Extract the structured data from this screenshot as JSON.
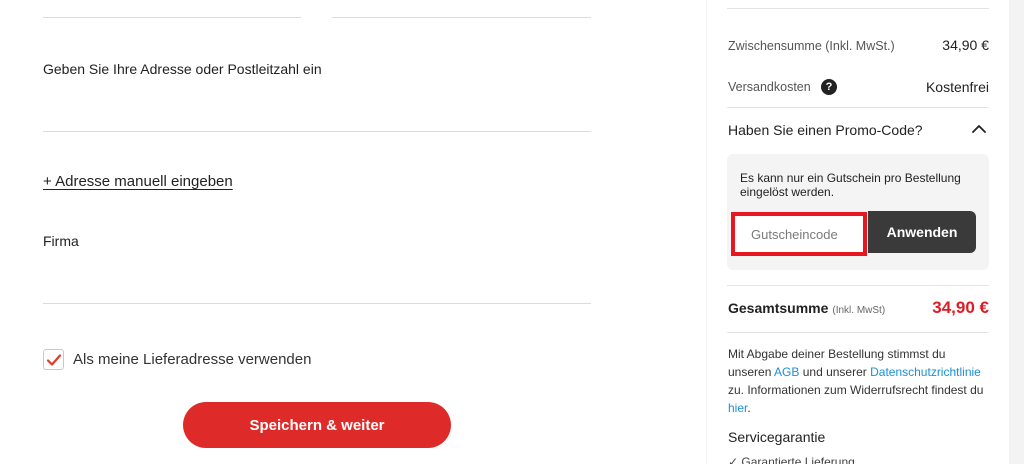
{
  "form": {
    "address_label": "Geben Sie Ihre Adresse oder Postleitzahl ein",
    "manual_address_link": "+ Adresse manuell eingeben",
    "company_label": "Firma",
    "use_as_shipping_label": "Als meine Lieferadresse verwenden",
    "use_as_shipping_checked": true,
    "submit_label": "Speichern & weiter"
  },
  "summary": {
    "subtotal_label": "Zwischensumme (Inkl. MwSt.)",
    "subtotal_value": "34,90 €",
    "shipping_label": "Versandkosten",
    "shipping_help_icon": "?",
    "shipping_value": "Kostenfrei",
    "promo": {
      "title": "Haben Sie einen Promo-Code?",
      "note": "Es kann nur ein Gutschein pro Bestellung eingelöst werden.",
      "voucher_placeholder": "Gutscheincode",
      "apply_label": "Anwenden"
    },
    "total_label": "Gesamtsumme",
    "total_note": "(Inkl. MwSt)",
    "total_value": "34,90 €",
    "legal": {
      "part1": "Mit Abgabe deiner Bestellung stimmst du unseren ",
      "agb_link": "AGB",
      "part2": " und unserer ",
      "privacy_link": "Datenschutzrichtlinie",
      "part3": " zu. Informationen zum Widerrufsrecht findest du ",
      "here_link": "hier",
      "part4": "."
    },
    "service_title": "Servicegarantie",
    "guarantee_item": "✓ Garantierte Lieferung"
  },
  "colors": {
    "primary_red": "#df2a2a",
    "total_red": "#e01b24",
    "highlight_red": "#e8171f",
    "link_blue": "#1a8fd8",
    "apply_dark": "#3a3a3a"
  }
}
